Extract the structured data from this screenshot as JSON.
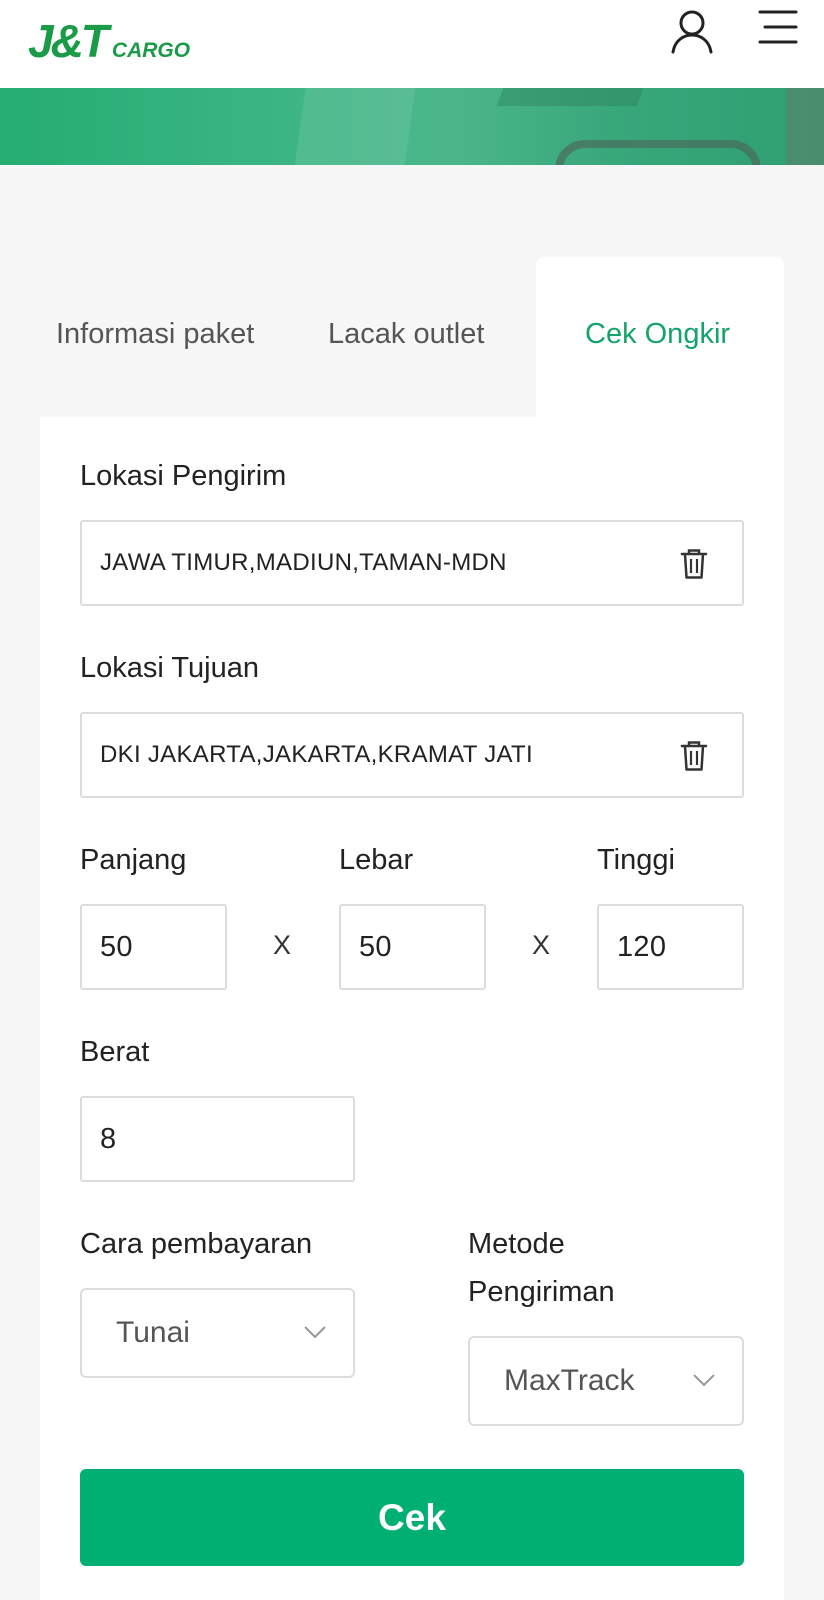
{
  "brand": {
    "logo_main": "J&T",
    "logo_sub": "CARGO",
    "color": "#1a9b47"
  },
  "header": {
    "user_icon": "user-icon",
    "menu_icon": "menu-icon"
  },
  "tabs": [
    {
      "label": "Informasi paket",
      "active": false
    },
    {
      "label": "Lacak outlet",
      "active": false
    },
    {
      "label": "Cek Ongkir",
      "active": true
    }
  ],
  "form": {
    "sender": {
      "label": "Lokasi Pengirim",
      "value": "JAWA TIMUR,MADIUN,TAMAN-MDN"
    },
    "destination": {
      "label": "Lokasi Tujuan",
      "value": "DKI JAKARTA,JAKARTA,KRAMAT JATI"
    },
    "length": {
      "label": "Panjang",
      "value": "50"
    },
    "width": {
      "label": "Lebar",
      "value": "50"
    },
    "height": {
      "label": "Tinggi",
      "value": "120"
    },
    "times_symbol": "X",
    "weight": {
      "label": "Berat",
      "value": "8"
    },
    "payment": {
      "label": "Cara pembayaran",
      "selected": "Tunai"
    },
    "shipping": {
      "label_line1": "Metode",
      "label_line2": "Pengiriman",
      "selected": "MaxTrack"
    },
    "submit_label": "Cek"
  },
  "colors": {
    "accent": "#00b072",
    "tab_active": "#14a46a",
    "banner": "#3cb583"
  }
}
